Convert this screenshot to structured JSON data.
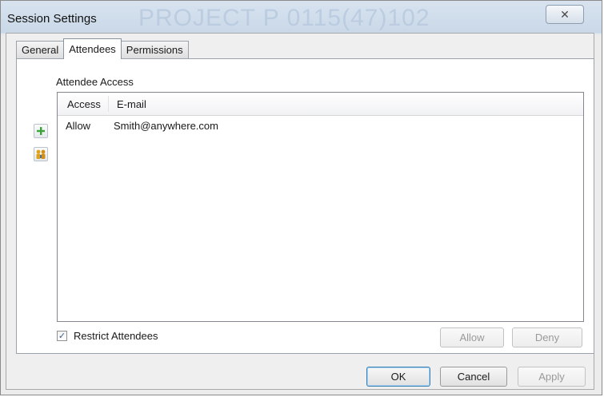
{
  "window": {
    "title": "Session Settings",
    "watermark": "PROJECT P 0115(47)102",
    "close_glyph": "✕"
  },
  "tabs": [
    {
      "label": "General",
      "active": false
    },
    {
      "label": "Attendees",
      "active": true
    },
    {
      "label": "Permissions",
      "active": false
    }
  ],
  "attendee_access": {
    "group_label": "Attendee Access",
    "add_button_icon": "plus-icon",
    "search_button_icon": "people-search-icon",
    "columns": [
      "Access",
      "E-mail"
    ],
    "rows": [
      {
        "access": "Allow",
        "email": "Smith@anywhere.com"
      }
    ]
  },
  "restrict": {
    "label": "Restrict Attendees",
    "checked": true,
    "check_glyph": "✓"
  },
  "row_buttons": {
    "allow": "Allow",
    "deny": "Deny"
  },
  "dialog_buttons": {
    "ok": "OK",
    "cancel": "Cancel",
    "apply": "Apply"
  },
  "colors": {
    "add_icon": "#3aa33a",
    "search_icon": "#e0a21a",
    "default_button_border": "#3c7fb1"
  }
}
